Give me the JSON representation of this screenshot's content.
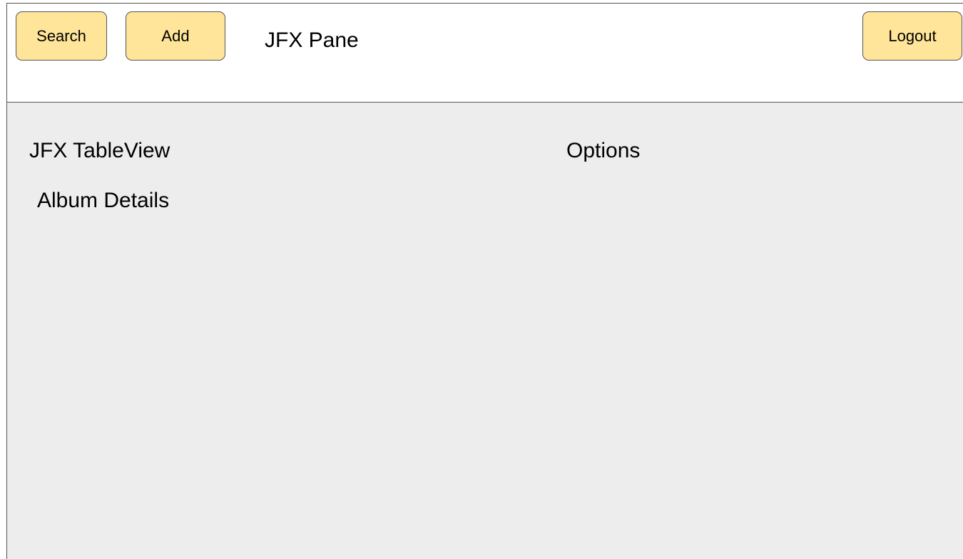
{
  "header": {
    "search_label": "Search",
    "add_label": "Add",
    "pane_title": "JFX Pane",
    "logout_label": "Logout"
  },
  "main": {
    "tableview_label": "JFX TableView",
    "album_details_label": "Album Details",
    "options_label": "Options"
  },
  "colors": {
    "button_fill": "#ffe599",
    "content_background": "#ededed",
    "border": "#555555"
  }
}
